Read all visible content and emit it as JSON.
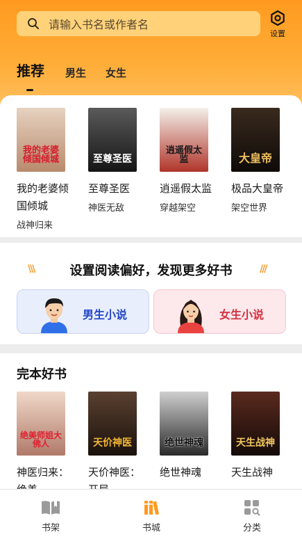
{
  "search": {
    "placeholder": "请输入书名或作者名"
  },
  "header": {
    "settings_label": "设置"
  },
  "tabs": [
    {
      "label": "推荐",
      "active": true
    },
    {
      "label": "男生",
      "active": false
    },
    {
      "label": "女生",
      "active": false
    }
  ],
  "recommend": {
    "books": [
      {
        "title": "我的老婆倾国倾城",
        "subtitle": "战神归来",
        "cover_text": "我的老婆倾国倾城",
        "cover_color": "#c9a58a"
      },
      {
        "title": "至尊圣医",
        "subtitle": "神医无敌",
        "cover_text": "至尊圣医",
        "cover_color": "#2a2a2a"
      },
      {
        "title": "逍遥假太监",
        "subtitle": "穿越架空",
        "cover_text": "逍遥假太监",
        "cover_color": "#e8e4de"
      },
      {
        "title": "极品大皇帝",
        "subtitle": "架空世界",
        "cover_text": "大皇帝",
        "cover_color": "#1c1410"
      }
    ]
  },
  "preference": {
    "title": "设置阅读偏好，发现更多好书",
    "male_label": "男生小说",
    "female_label": "女生小说"
  },
  "finished": {
    "title": "完本好书",
    "books": [
      {
        "title": "神医归来：绝美",
        "cover_text": "绝美师姐大佛人",
        "cover_color": "#d9b3a4"
      },
      {
        "title": "天价神医：开局",
        "cover_text": "天价神医",
        "cover_color": "#2b2118"
      },
      {
        "title": "绝世神魂",
        "cover_text": "绝世神魂",
        "cover_color": "#3a3a3a"
      },
      {
        "title": "天生战神",
        "cover_text": "天生战神",
        "cover_color": "#2e1a14"
      }
    ]
  },
  "nav": [
    {
      "label": "书架",
      "icon": "bookshelf-icon",
      "active": false
    },
    {
      "label": "书城",
      "icon": "bookstore-icon",
      "active": true
    },
    {
      "label": "分类",
      "icon": "category-icon",
      "active": false
    }
  ],
  "colors": {
    "accent": "#ff9a1f",
    "male": "#2345c8",
    "female": "#d2303f"
  }
}
